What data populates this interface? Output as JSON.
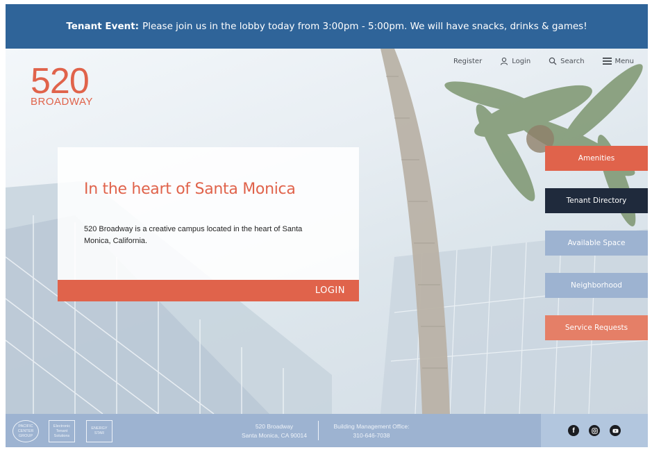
{
  "banner": {
    "label": "Tenant Event:",
    "message": "Please join us in the lobby today from 3:00pm - 5:00pm. We will have snacks, drinks & games!"
  },
  "logo": {
    "number": "520",
    "word": "BROADWAY"
  },
  "nav": {
    "register": "Register",
    "login": "Login",
    "search": "Search",
    "menu": "Menu"
  },
  "intro": {
    "title": "In the heart of Santa Monica",
    "body": "520 Broadway is a creative campus located in the heart of Santa Monica, California.",
    "login_label": "LOGIN"
  },
  "sidebar": {
    "items": [
      {
        "label": "Amenities",
        "color": "#e0634b"
      },
      {
        "label": "Tenant Directory",
        "color": "#1f2a3c"
      },
      {
        "label": "Available Space",
        "color": "#9db3d1"
      },
      {
        "label": "Neighborhood",
        "color": "#9db3d1"
      },
      {
        "label": "Service Requests",
        "color": "#e57f67"
      }
    ]
  },
  "footer": {
    "address_line1": "520 Broadway",
    "address_line2": "Santa Monica, CA 90014",
    "mgmt_line1": "Building Management Office:",
    "mgmt_line2": "310-646-7038",
    "badges": [
      "PACIFIC CENTER GROUP",
      "Electronic Tenant Solutions",
      "ENERGY STAR"
    ],
    "social": [
      "facebook-icon",
      "instagram-icon",
      "youtube-icon"
    ]
  },
  "colors": {
    "accent": "#e0634b",
    "banner": "#2f6499",
    "footer": "#9db3d1",
    "navy": "#1f2a3c"
  }
}
